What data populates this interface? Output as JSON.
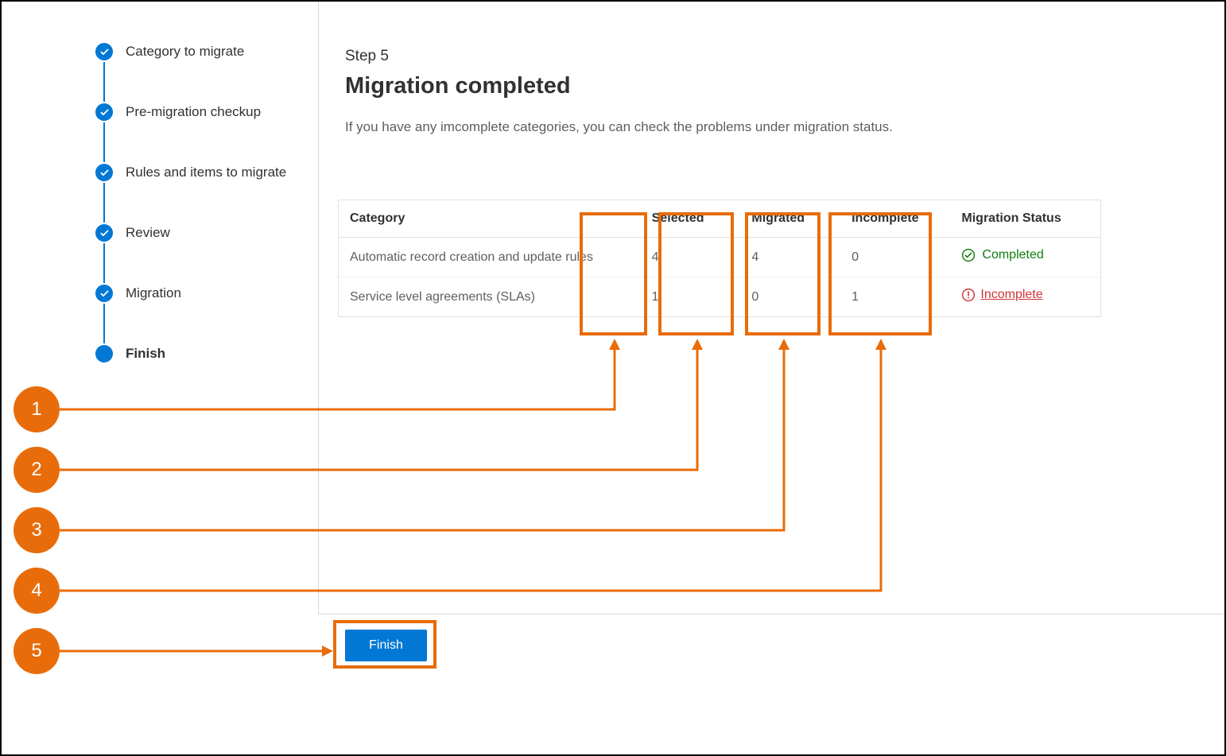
{
  "stepper": {
    "items": [
      {
        "label": "Category to migrate",
        "state": "done"
      },
      {
        "label": "Pre-migration checkup",
        "state": "done"
      },
      {
        "label": "Rules and items to migrate",
        "state": "done"
      },
      {
        "label": "Review",
        "state": "done"
      },
      {
        "label": "Migration",
        "state": "done"
      },
      {
        "label": "Finish",
        "state": "current"
      }
    ]
  },
  "main": {
    "step_number": "Step 5",
    "title": "Migration completed",
    "description": "If you have any imcomplete categories, you can check the problems under migration status."
  },
  "table": {
    "headers": {
      "category": "Category",
      "selected": "Selected",
      "migrated": "Migrated",
      "incomplete": "Incomplete",
      "status": "Migration Status"
    },
    "rows": [
      {
        "category": "Automatic record creation and update rules",
        "selected": "4",
        "migrated": "4",
        "incomplete": "0",
        "status_text": "Completed",
        "status_kind": "completed"
      },
      {
        "category": "Service level agreements (SLAs)",
        "selected": "1",
        "migrated": "0",
        "incomplete": "1",
        "status_text": "Incomplete",
        "status_kind": "incomplete"
      }
    ]
  },
  "footer": {
    "finish_label": "Finish"
  },
  "annotations": {
    "callouts": [
      "1",
      "2",
      "3",
      "4",
      "5"
    ]
  }
}
